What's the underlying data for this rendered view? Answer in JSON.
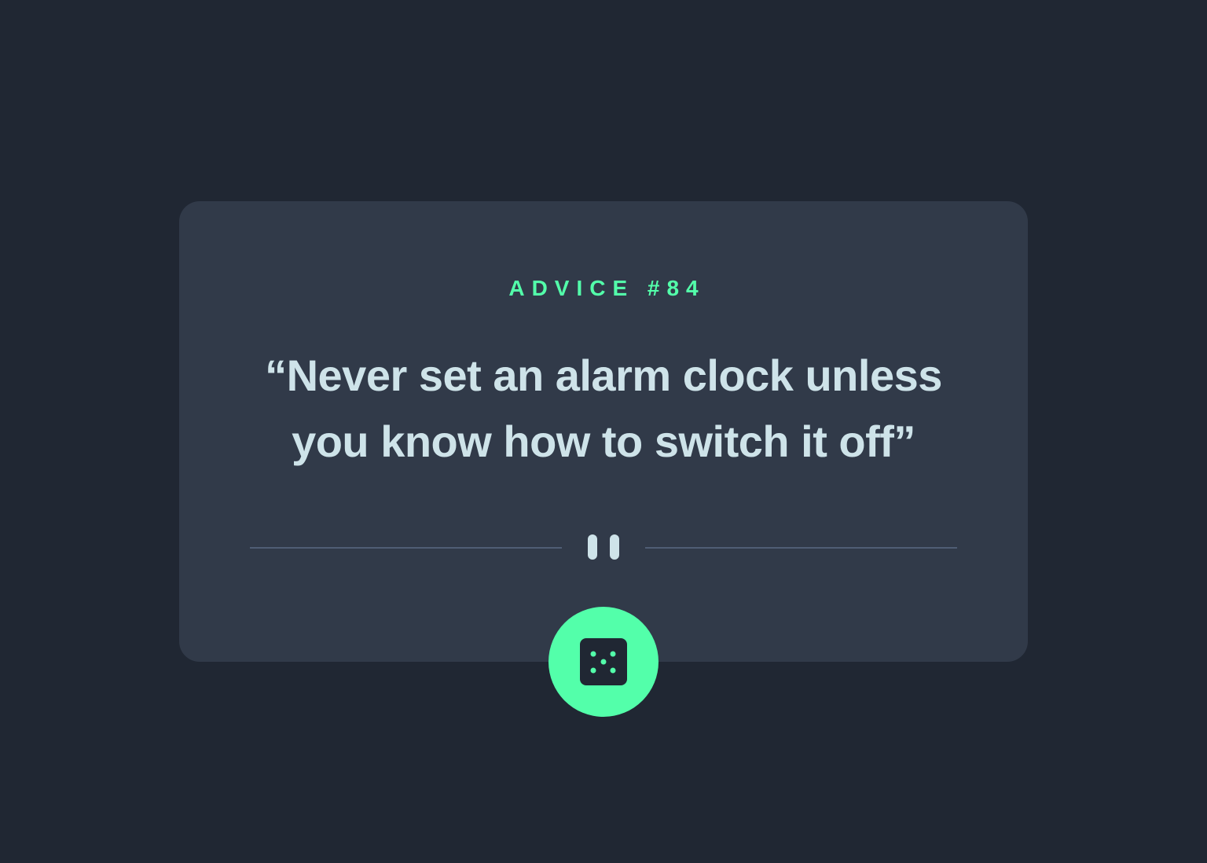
{
  "advice": {
    "heading": "ADVICE #84",
    "text": "“Never set an alarm clock unless you know how to switch it off”"
  },
  "icons": {
    "divider": "pause-icon",
    "button": "dice-icon"
  },
  "colors": {
    "background": "#202733",
    "card": "#313A49",
    "accent": "#53FFAA",
    "text": "#CEE3E9",
    "divider": "#4F5D74"
  }
}
